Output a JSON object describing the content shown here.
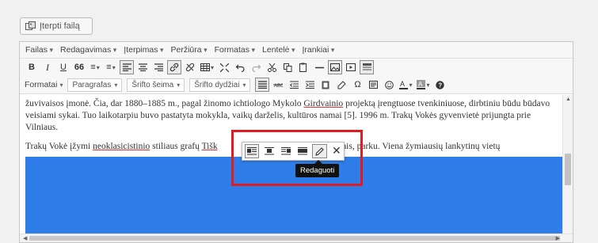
{
  "insert_media": {
    "label": "Įterpti failą",
    "icon": "media-icon"
  },
  "menubar": {
    "items": [
      "Failas",
      "Redagavimas",
      "Įterpimas",
      "Peržiūra",
      "Formatas",
      "Lentelė",
      "Įrankiai"
    ]
  },
  "toolbar1": {
    "bold": "B",
    "italic": "I",
    "underline": "U",
    "blockquote": "66",
    "bullet_list": "≡",
    "numbered_list": "≡"
  },
  "toolbar2": {
    "formats": "Formatai",
    "paragraph": "Paragrafas",
    "font_family": "Šrifto šeima",
    "font_size": "Šrifto dydžiai"
  },
  "content": {
    "para1_a": "žuvivaisos įmonė. Čia, dar 1880–1885 m., pagal žinomo ichtiologo Mykolo ",
    "para1_name": "Girdvainio",
    "para1_b": " projektą įrengtuose tvenkiniuose, dirbtiniu būdu būdavo veisiami sykai. Tuo laikotarpiu buvo pastatyta mokykla, vaikų darželis, kultūros namai [5]. 1996 m. Trakų Vokės gyvenvietė prijungta prie Vilniaus.",
    "para2_a": "Trakų Vokė įžymi ",
    "para2_neo": "neoklasicistinio",
    "para2_b": " stiliaus grafų ",
    "para2_tys": "Tišk",
    "para2_c": "                                        ",
    "para2_d": "ais pastatais, parku. Viena žymiausių lankytinų vietų"
  },
  "image_toolbar": {
    "tooltip": "Redaguoti"
  },
  "colors": {
    "image_blue": "#2f7de9",
    "highlight_red": "#e11b22"
  }
}
